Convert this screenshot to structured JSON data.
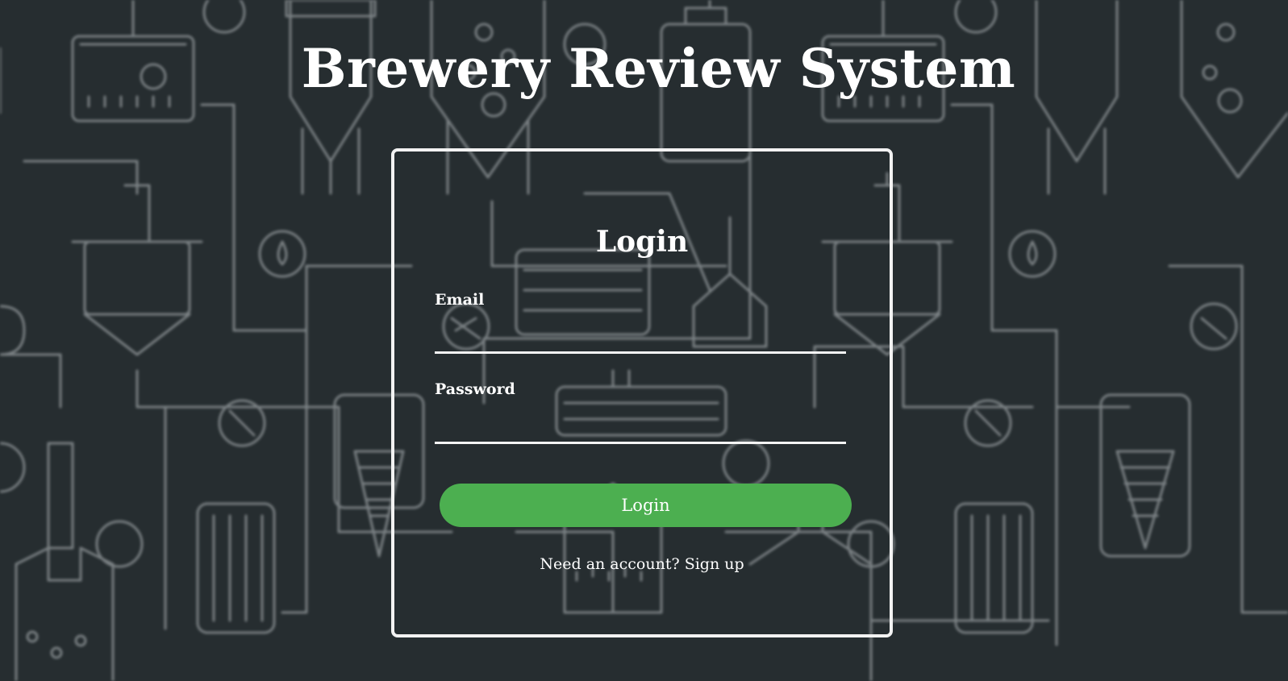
{
  "app": {
    "title": "Brewery Review System"
  },
  "login": {
    "heading": "Login",
    "email_label": "Email",
    "email_value": "",
    "password_label": "Password",
    "password_value": "",
    "submit_label": "Login",
    "signup_prompt": "Need an account?",
    "signup_link": "Sign up"
  },
  "theme": {
    "background": "#262d30",
    "accent": "#4caf50",
    "text": "#ffffff"
  }
}
